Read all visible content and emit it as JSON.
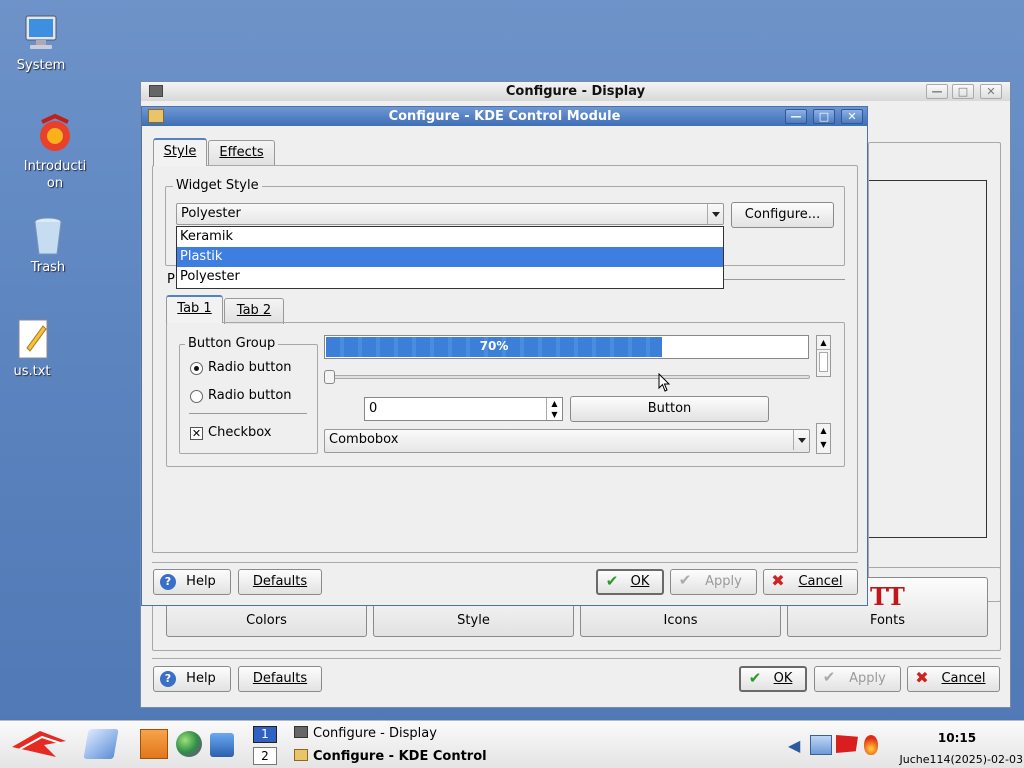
{
  "desktop": {
    "icons": [
      {
        "label": "System",
        "icon": "computer-icon"
      },
      {
        "label": "Introduction",
        "icon": "kde-gear-icon"
      },
      {
        "label": "Trash",
        "icon": "trash-icon"
      },
      {
        "label": "us.txt",
        "icon": "text-file-icon"
      }
    ]
  },
  "back_window": {
    "title": "Configure - Display",
    "categories": [
      {
        "label": "Colors"
      },
      {
        "label": "Style"
      },
      {
        "label": "Icons"
      },
      {
        "label": "Fonts"
      }
    ],
    "help_label": "Help",
    "defaults_label": "Defaults",
    "ok_label": "OK",
    "apply_label": "Apply",
    "cancel_label": "Cancel"
  },
  "front_window": {
    "title": "Configure - KDE Control Module",
    "tabs": [
      {
        "label": "Style"
      },
      {
        "label": "Effects"
      }
    ],
    "widget_style": {
      "group_label": "Widget Style",
      "selected": "Polyester",
      "options": [
        "Keramik",
        "Plastik",
        "Polyester"
      ],
      "highlighted": "Plastik",
      "configure_label": "Configure..."
    },
    "preview_letter": "P",
    "preview_tabs": [
      {
        "label": "Tab 1"
      },
      {
        "label": "Tab 2"
      }
    ],
    "button_group": {
      "label": "Button Group",
      "radio1": "Radio button",
      "radio2": "Radio button",
      "checkbox": "Checkbox"
    },
    "progress": {
      "text": "70%",
      "value": 0.7
    },
    "spin_value": "0",
    "button_label": "Button",
    "combobox_value": "Combobox",
    "help_label": "Help",
    "defaults_label": "Defaults",
    "ok_label": "OK",
    "apply_label": "Apply",
    "cancel_label": "Cancel"
  },
  "taskbar": {
    "desktops": [
      "1",
      "2"
    ],
    "tasks": [
      {
        "label": "Configure - Display",
        "active": false
      },
      {
        "label": "Configure - KDE Control Module",
        "active": true
      }
    ],
    "clock_time": "10:15",
    "clock_date": "Juche114(2025)-02-03"
  },
  "colors": {
    "accent": "#3d7ee0",
    "titlebar_active": "#4f7dc2",
    "desktop": "#5c84bf"
  }
}
